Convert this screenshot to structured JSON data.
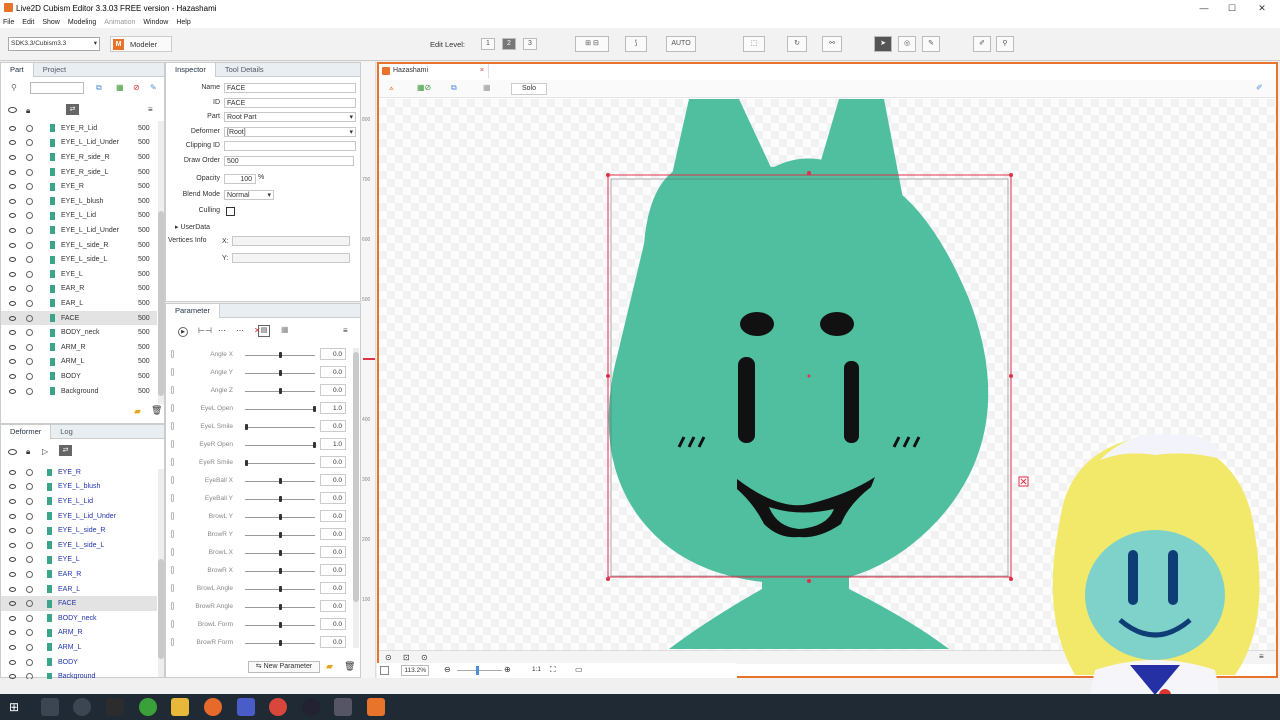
{
  "window": {
    "title": "Live2D Cubism Editor 3.3.03   FREE version - Hazashami",
    "minimize": "—",
    "maximize": "☐",
    "close": "✕"
  },
  "menu": [
    "File",
    "Edit",
    "Show",
    "Modeling",
    "Animation",
    "Window",
    "Help"
  ],
  "toolbar": {
    "sdk_select": "SDK3.3/Cubism3.3",
    "mode_label": "Modeler",
    "mode_letter": "M",
    "edit_level_label": "Edit Level:",
    "levels": [
      "1",
      "2",
      "3"
    ],
    "auto_label": "AUTO"
  },
  "parts_panel": {
    "tabs": [
      "Part",
      "Project"
    ],
    "rows": [
      {
        "name": "EYE_R_Lid",
        "value": "500"
      },
      {
        "name": "EYE_L_Lid_Under",
        "value": "500"
      },
      {
        "name": "EYE_R_side_R",
        "value": "500"
      },
      {
        "name": "EYE_R_side_L",
        "value": "500"
      },
      {
        "name": "EYE_R",
        "value": "500"
      },
      {
        "name": "EYE_L_blush",
        "value": "500"
      },
      {
        "name": "EYE_L_Lid",
        "value": "500"
      },
      {
        "name": "EYE_L_Lid_Under",
        "value": "500"
      },
      {
        "name": "EYE_L_side_R",
        "value": "500"
      },
      {
        "name": "EYE_L_side_L",
        "value": "500"
      },
      {
        "name": "EYE_L",
        "value": "500"
      },
      {
        "name": "EAR_R",
        "value": "500"
      },
      {
        "name": "EAR_L",
        "value": "500"
      },
      {
        "name": "FACE",
        "value": "500"
      },
      {
        "name": "BODY_neck",
        "value": "500"
      },
      {
        "name": "ARM_R",
        "value": "500"
      },
      {
        "name": "ARM_L",
        "value": "500"
      },
      {
        "name": "BODY",
        "value": "500"
      },
      {
        "name": "Background",
        "value": "500"
      }
    ]
  },
  "deformer_panel": {
    "tabs": [
      "Deformer",
      "Log"
    ],
    "rows": [
      "EYE_R",
      "EYE_L_blush",
      "EYE_L_Lid",
      "EYE_L_Lid_Under",
      "EYE_L_side_R",
      "EYE_L_side_L",
      "EYE_L",
      "EAR_R",
      "EAR_L",
      "FACE",
      "BODY_neck",
      "ARM_R",
      "ARM_L",
      "BODY",
      "Background"
    ]
  },
  "inspector": {
    "tabs": [
      "Inspector",
      "Tool Details"
    ],
    "name_label": "Name",
    "name_value": "FACE",
    "id_label": "ID",
    "id_value": "FACE",
    "part_label": "Part",
    "part_value": "Root Part",
    "deformer_label": "Deformer",
    "deformer_value": "[Root]",
    "clipping_label": "Clipping ID",
    "clipping_value": "",
    "draw_order_label": "Draw Order",
    "draw_order_value": "500",
    "opacity_label": "Opacity",
    "opacity_value": "100",
    "opacity_unit": "%",
    "blend_label": "Blend Mode",
    "blend_value": "Normal",
    "culling_label": "Culling",
    "userdata_label": "UserData",
    "vertices_label": "Vertices Info",
    "x_label": "X:",
    "y_label": "Y:"
  },
  "parameter_panel": {
    "tab": "Parameter",
    "params": [
      {
        "name": "Angle X",
        "value": "0.0",
        "pos": 0.5
      },
      {
        "name": "Angle Y",
        "value": "0.0",
        "pos": 0.5
      },
      {
        "name": "Angle Z",
        "value": "0.0",
        "pos": 0.5
      },
      {
        "name": "EyeL Open",
        "value": "1.0",
        "pos": 1.0
      },
      {
        "name": "EyeL Smile",
        "value": "0.0",
        "pos": 0.0
      },
      {
        "name": "EyeR Open",
        "value": "1.0",
        "pos": 1.0
      },
      {
        "name": "EyeR Smile",
        "value": "0.0",
        "pos": 0.0
      },
      {
        "name": "EyeBall X",
        "value": "0.0",
        "pos": 0.5
      },
      {
        "name": "EyeBall Y",
        "value": "0.0",
        "pos": 0.5
      },
      {
        "name": "BrowL Y",
        "value": "0.0",
        "pos": 0.5
      },
      {
        "name": "BrowR Y",
        "value": "0.0",
        "pos": 0.5
      },
      {
        "name": "BrowL X",
        "value": "0.0",
        "pos": 0.5
      },
      {
        "name": "BrowR X",
        "value": "0.0",
        "pos": 0.5
      },
      {
        "name": "BrowL Angle",
        "value": "0.0",
        "pos": 0.5
      },
      {
        "name": "BrowR Angle",
        "value": "0.0",
        "pos": 0.5
      },
      {
        "name": "BrowL Form",
        "value": "0.0",
        "pos": 0.5
      },
      {
        "name": "BrowR Form",
        "value": "0.0",
        "pos": 0.5
      }
    ],
    "new_parameter": "New Parameter"
  },
  "canvas": {
    "tab_title": "Hazashami",
    "solo_label": "Solo",
    "zoom": "113.2%",
    "ratio": "1:1",
    "ruler_labels": [
      "800",
      "700",
      "600",
      "500",
      "400",
      "300",
      "200",
      "100"
    ]
  },
  "colors": {
    "face": "#4fbfa0",
    "accent": "#e8732a",
    "selection": "#e0304a"
  }
}
